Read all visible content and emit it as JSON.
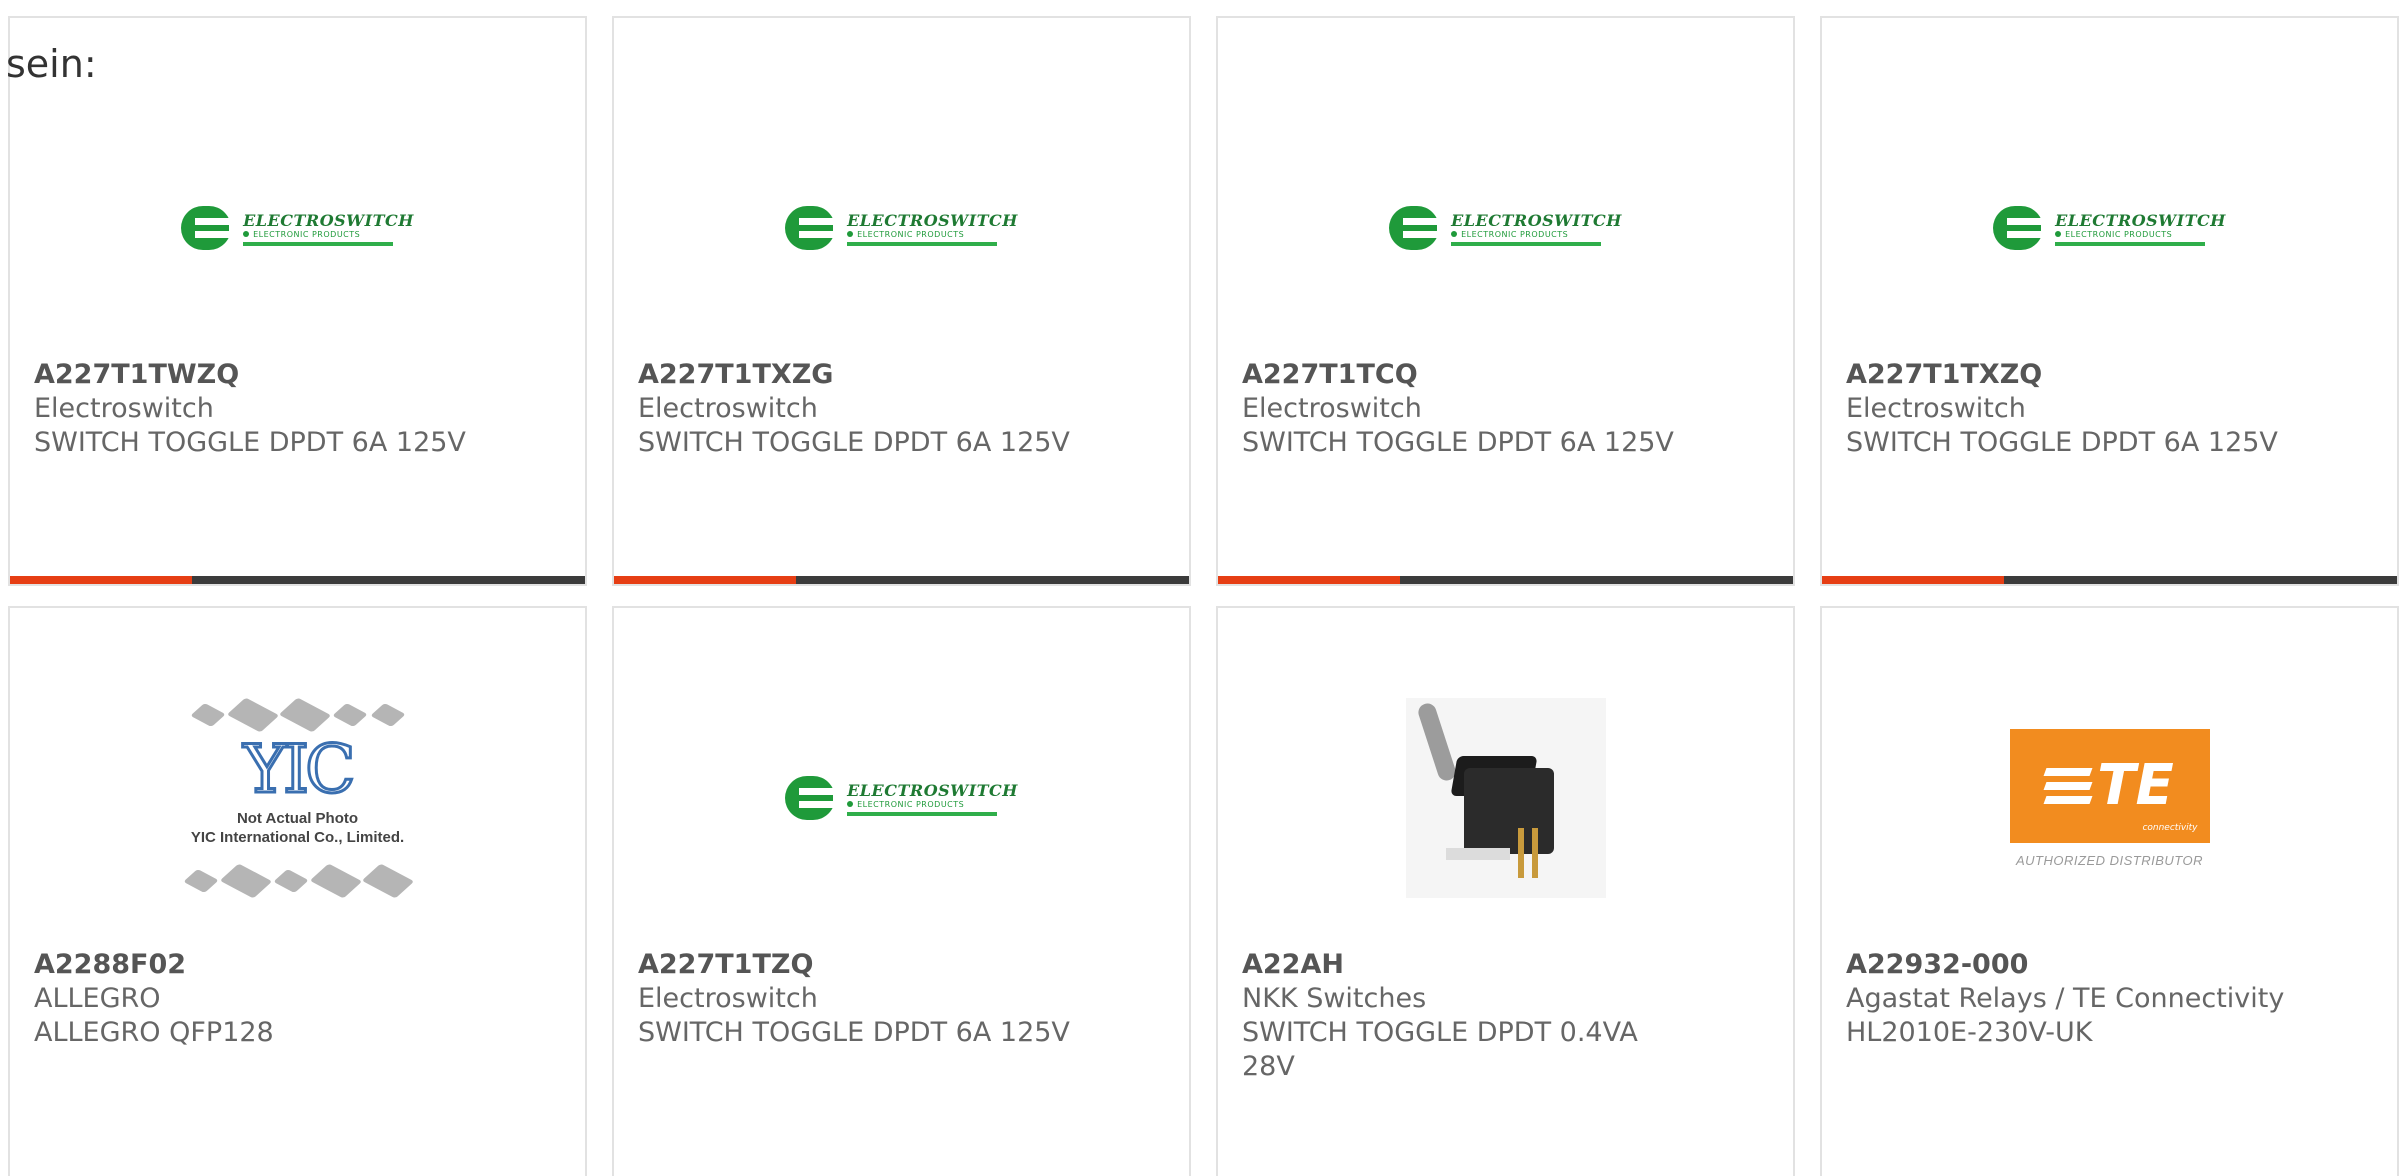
{
  "page": {
    "heading": "sein:"
  },
  "brand": {
    "accent_red": "#e63e14",
    "bar_dark": "#3b3b3b",
    "es_green": "#1f9a3a",
    "te_orange": "#f28c1f"
  },
  "logos": {
    "electroswitch": {
      "name": "ELECTROSWITCH",
      "sub": "ELECTRONIC PRODUCTS"
    },
    "yic": {
      "mark": "YIC",
      "caption_line1": "Not Actual Photo",
      "caption_line2": "YIC International Co., Limited."
    },
    "te": {
      "mark": "TE",
      "sub": "connectivity",
      "authorized": "AUTHORIZED DISTRIBUTOR"
    }
  },
  "products": [
    {
      "part": "A227T1TWZQ",
      "maker": "Electroswitch",
      "desc": "SWITCH TOGGLE DPDT 6A 125V",
      "image": "electroswitch-logo"
    },
    {
      "part": "A227T1TXZG",
      "maker": "Electroswitch",
      "desc": "SWITCH TOGGLE DPDT 6A 125V",
      "image": "electroswitch-logo"
    },
    {
      "part": "A227T1TCQ",
      "maker": "Electroswitch",
      "desc": "SWITCH TOGGLE DPDT 6A 125V",
      "image": "electroswitch-logo"
    },
    {
      "part": "A227T1TXZQ",
      "maker": "Electroswitch",
      "desc": "SWITCH TOGGLE DPDT 6A 125V",
      "image": "electroswitch-logo"
    },
    {
      "part": "A2288F02",
      "maker": "ALLEGRO",
      "desc": "ALLEGRO QFP128",
      "image": "yic-placeholder"
    },
    {
      "part": "A227T1TZQ",
      "maker": "Electroswitch",
      "desc": "SWITCH TOGGLE DPDT 6A 125V",
      "image": "electroswitch-logo"
    },
    {
      "part": "A22AH",
      "maker": "NKK Switches",
      "desc": "SWITCH TOGGLE DPDT 0.4VA 28V",
      "image": "toggle-switch-photo"
    },
    {
      "part": "A22932-000",
      "maker": "Agastat Relays / TE Connectivity",
      "desc": "HL2010E-230V-UK",
      "image": "te-logo"
    }
  ]
}
